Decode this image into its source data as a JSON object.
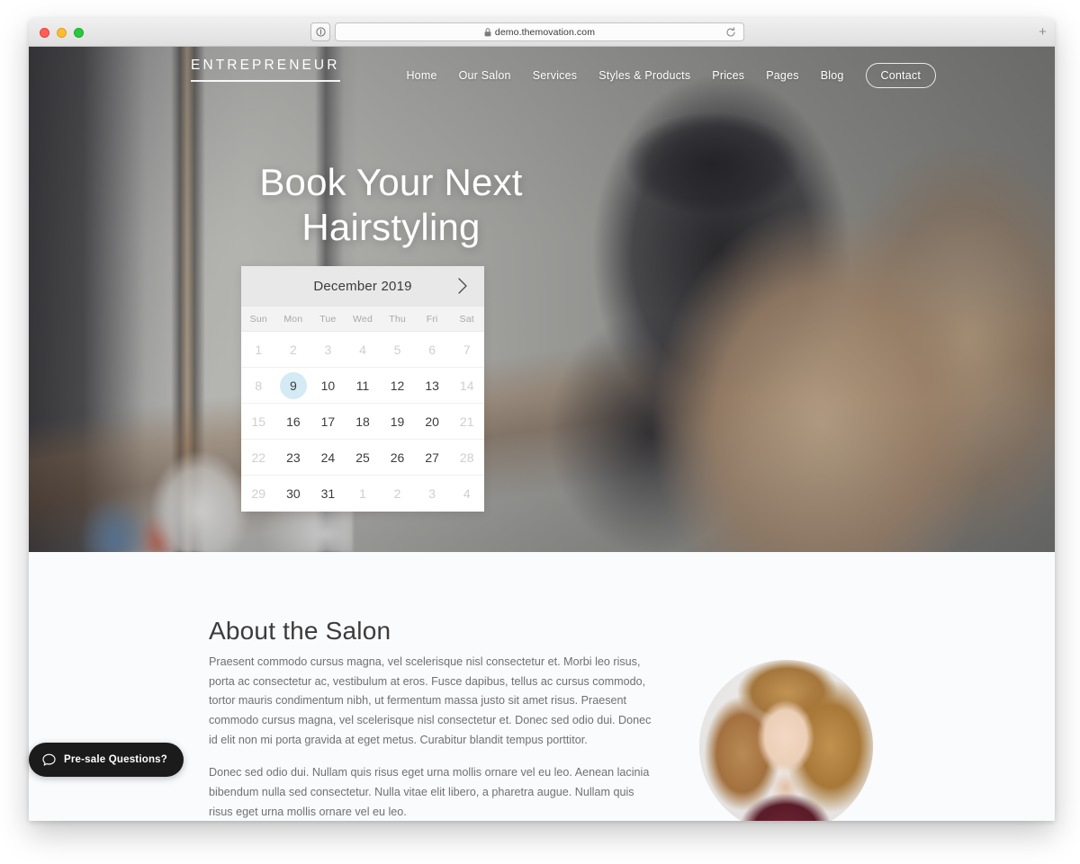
{
  "browser": {
    "url": "demo.themovation.com",
    "lock_icon": "lock-icon",
    "reader_icon": "reader-view-icon",
    "reload_icon": "reload-icon",
    "newtab_label": "+",
    "traffic_lights": [
      "close",
      "minimize",
      "maximize"
    ]
  },
  "site": {
    "brand": "ENTREPRENEUR",
    "nav": [
      {
        "label": "Home"
      },
      {
        "label": "Our Salon"
      },
      {
        "label": "Services"
      },
      {
        "label": "Styles & Products"
      },
      {
        "label": "Prices"
      },
      {
        "label": "Pages"
      },
      {
        "label": "Blog"
      },
      {
        "label": "Contact"
      }
    ],
    "hero": {
      "title_line1": "Book Your Next",
      "title_line2": "Hairstyling"
    },
    "calendar": {
      "month_label": "December 2019",
      "next_icon": "chevron-right-icon",
      "weekdays": [
        "Sun",
        "Mon",
        "Tue",
        "Wed",
        "Thu",
        "Fri",
        "Sat"
      ],
      "selected_day": "9",
      "highlight_color": "#d4eaf4",
      "weeks": [
        [
          {
            "d": "1",
            "muted": true
          },
          {
            "d": "2",
            "muted": true
          },
          {
            "d": "3",
            "muted": true
          },
          {
            "d": "4",
            "muted": true
          },
          {
            "d": "5",
            "muted": true
          },
          {
            "d": "6",
            "muted": true
          },
          {
            "d": "7",
            "muted": true
          }
        ],
        [
          {
            "d": "8",
            "muted": true
          },
          {
            "d": "9",
            "muted": false,
            "selected": true
          },
          {
            "d": "10",
            "muted": false
          },
          {
            "d": "11",
            "muted": false
          },
          {
            "d": "12",
            "muted": false
          },
          {
            "d": "13",
            "muted": false
          },
          {
            "d": "14",
            "muted": true
          }
        ],
        [
          {
            "d": "15",
            "muted": true
          },
          {
            "d": "16",
            "muted": false
          },
          {
            "d": "17",
            "muted": false
          },
          {
            "d": "18",
            "muted": false
          },
          {
            "d": "19",
            "muted": false
          },
          {
            "d": "20",
            "muted": false
          },
          {
            "d": "21",
            "muted": true
          }
        ],
        [
          {
            "d": "22",
            "muted": true
          },
          {
            "d": "23",
            "muted": false
          },
          {
            "d": "24",
            "muted": false
          },
          {
            "d": "25",
            "muted": false
          },
          {
            "d": "26",
            "muted": false
          },
          {
            "d": "27",
            "muted": false
          },
          {
            "d": "28",
            "muted": true
          }
        ],
        [
          {
            "d": "29",
            "muted": true
          },
          {
            "d": "30",
            "muted": false
          },
          {
            "d": "31",
            "muted": false
          },
          {
            "d": "1",
            "muted": true
          },
          {
            "d": "2",
            "muted": true
          },
          {
            "d": "3",
            "muted": true
          },
          {
            "d": "4",
            "muted": true
          }
        ]
      ]
    },
    "about": {
      "heading": "About the Salon",
      "paragraph1": "Praesent commodo cursus magna, vel scelerisque nisl consectetur et. Morbi leo risus, porta ac consectetur ac, vestibulum at eros. Fusce dapibus, tellus ac cursus commodo, tortor mauris condimentum nibh, ut fermentum massa justo sit amet risus. Praesent commodo cursus magna, vel scelerisque nisl consectetur et. Donec sed odio dui. Donec id elit non mi porta gravida at eget metus. Curabitur blandit tempus porttitor.",
      "paragraph2": "Donec sed odio dui. Nullam quis risus eget urna mollis ornare vel eu leo. Aenean lacinia bibendum nulla sed consectetur. Nulla vitae elit libero, a pharetra augue. Nullam quis risus eget urna mollis ornare vel eu leo.",
      "avatar_alt": "salon-stylist-portrait"
    },
    "chat_widget": {
      "label": "Pre-sale Questions?",
      "icon": "chat-bubble-icon",
      "background_color": "#1b1b1b"
    }
  }
}
